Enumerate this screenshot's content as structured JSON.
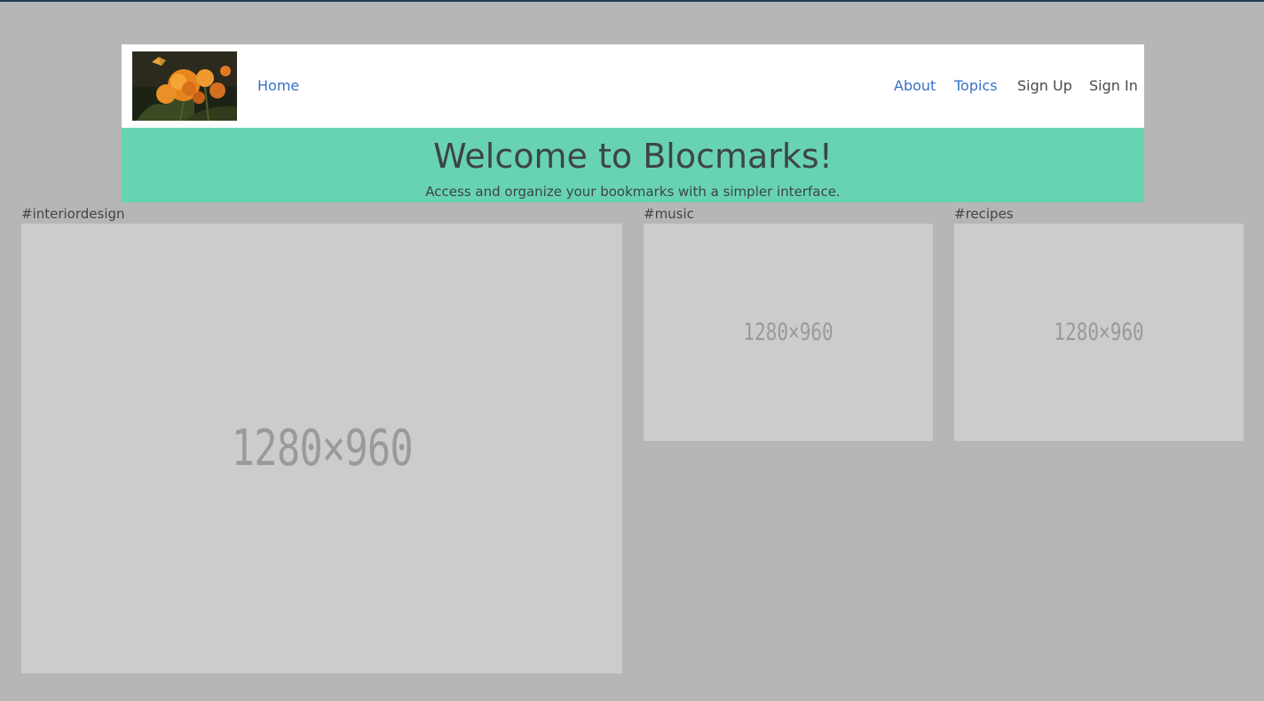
{
  "nav": {
    "logo_alt": "flowers logo",
    "home": "Home",
    "about": "About",
    "topics": "Topics",
    "sign_up": "Sign Up",
    "sign_in": "Sign In"
  },
  "hero": {
    "title": "Welcome to Blocmarks!",
    "subtitle": "Access and organize your bookmarks with a simpler interface."
  },
  "topics": [
    {
      "title": "#interiordesign",
      "image_label": "1280×960"
    },
    {
      "title": "#music",
      "image_label": "1280×960"
    },
    {
      "title": "#recipes",
      "image_label": "1280×960"
    }
  ],
  "colors": {
    "background": "#b6b6b6",
    "hero": "#67d3b2",
    "link": "#3a6fc7",
    "placeholder": "#cccccc"
  }
}
